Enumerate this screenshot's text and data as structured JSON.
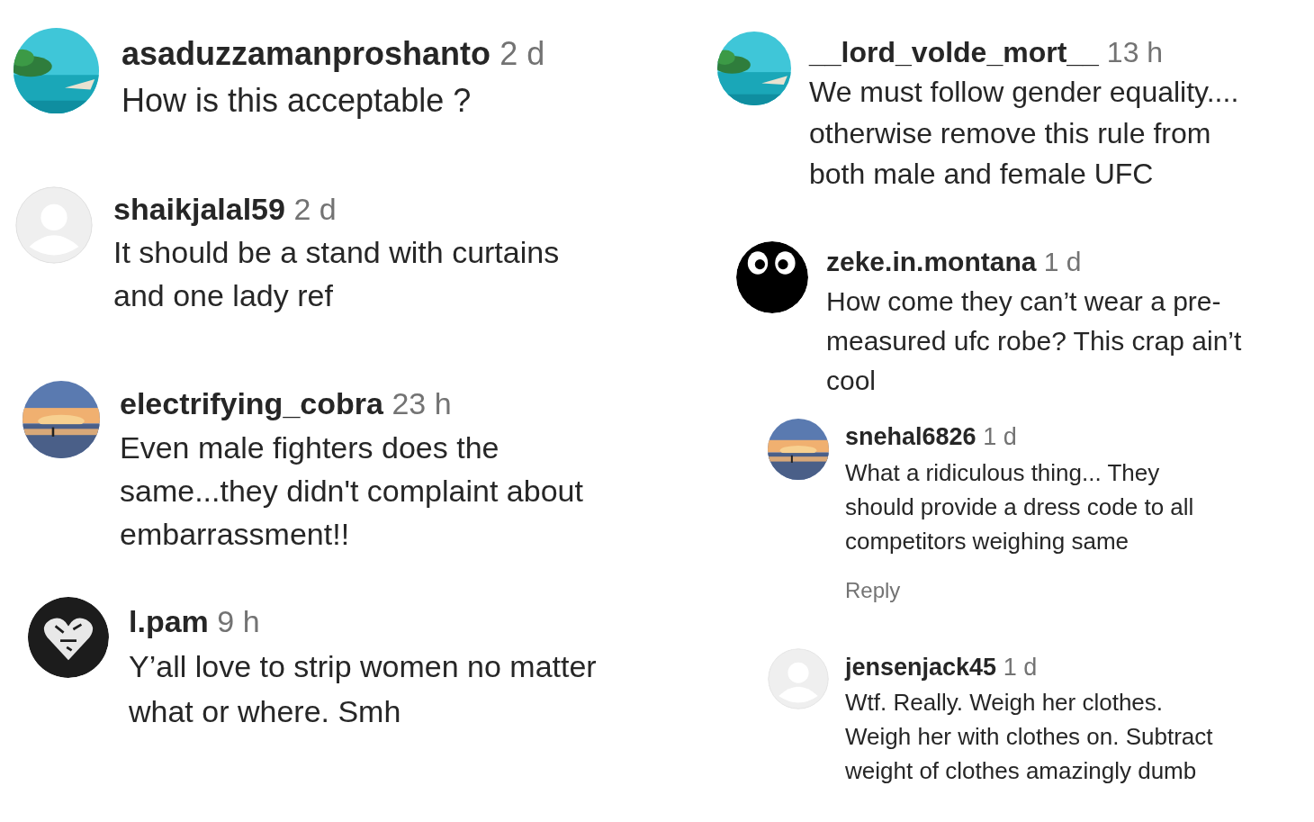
{
  "columns": [
    {
      "comments": [
        {
          "username": "asaduzzamanproshanto",
          "time": "2 d",
          "text": "How is this acceptable ?"
        },
        {
          "avatar": {
            "kind": "default"
          },
          "username": "shaikjalal59",
          "time": "2 d",
          "text": "It should be a stand with curtains\nand one lady ref"
        },
        {
          "username": "electrifying_cobra",
          "time": "23 h",
          "text": "Even male fighters does the\nsame...they didn't complaint about\nembarrassment!!"
        },
        {
          "avatar": {
            "kind": "heart"
          },
          "username": "l.pam",
          "time": "9 h",
          "text": "Y’all love to strip women no matter\nwhat or where. Smh"
        }
      ]
    },
    {
      "comments": [
        {
          "username": "__lord_volde_mort__",
          "time": "13 h",
          "text": "We must follow gender equality....\notherwise remove this rule from\nboth male and female UFC"
        },
        {
          "avatar": {
            "kind": "cartoon"
          },
          "username": "zeke.in.montana",
          "time": "1 d",
          "text": "How come they can’t wear a pre-\nmeasured ufc robe? This crap ain’t\ncool"
        },
        {
          "username": "snehal6826",
          "time": "1 d",
          "text": "What a ridiculous thing... They\nshould provide a dress code to all\ncompetitors weighing same",
          "reply_link": "Reply"
        },
        {
          "avatar": {
            "kind": "default"
          },
          "username": "jensenjack45",
          "time": "1 d",
          "text": "Wtf. Really. Weigh her clothes.\nWeigh her with clothes on. Subtract\nweight of clothes amazingly dumb"
        }
      ]
    }
  ]
}
